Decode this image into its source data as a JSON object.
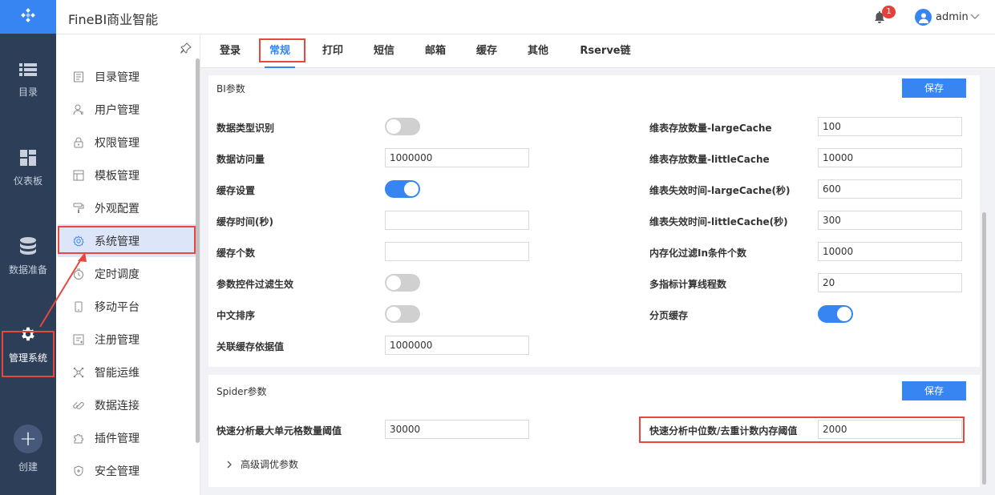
{
  "app": {
    "title": "FineBI商业智能"
  },
  "header": {
    "notification_count": "1",
    "username": "admin"
  },
  "leftnav": [
    {
      "label": "目录",
      "icon": "list-icon"
    },
    {
      "label": "仪表板",
      "icon": "dashboard-icon"
    },
    {
      "label": "数据准备",
      "icon": "database-icon"
    },
    {
      "label": "管理系统",
      "icon": "gear-icon",
      "active": true
    },
    {
      "label": "创建",
      "icon": "plus-icon"
    }
  ],
  "sidebar": {
    "items": [
      {
        "label": "目录管理"
      },
      {
        "label": "用户管理"
      },
      {
        "label": "权限管理"
      },
      {
        "label": "模板管理"
      },
      {
        "label": "外观配置"
      },
      {
        "label": "系统管理",
        "active": true
      },
      {
        "label": "定时调度"
      },
      {
        "label": "移动平台"
      },
      {
        "label": "注册管理"
      },
      {
        "label": "智能运维"
      },
      {
        "label": "数据连接"
      },
      {
        "label": "插件管理"
      },
      {
        "label": "安全管理"
      }
    ]
  },
  "tabs": [
    "登录",
    "常规",
    "打印",
    "短信",
    "邮箱",
    "缓存",
    "其他",
    "Rserve链接"
  ],
  "active_tab": "常规",
  "bi_params": {
    "title": "BI参数",
    "save_label": "保存",
    "left": [
      {
        "label": "数据类型识别",
        "type": "toggle",
        "on": false
      },
      {
        "label": "数据访问量",
        "type": "input",
        "value": "1000000"
      },
      {
        "label": "缓存设置",
        "type": "toggle",
        "on": true
      },
      {
        "label": "缓存时间(秒)",
        "type": "input",
        "value": ""
      },
      {
        "label": "缓存个数",
        "type": "input",
        "value": ""
      },
      {
        "label": "参数控件过滤生效",
        "type": "toggle",
        "on": false
      },
      {
        "label": "中文排序",
        "type": "toggle",
        "on": false
      },
      {
        "label": "关联缓存依据值",
        "type": "input",
        "value": "1000000"
      }
    ],
    "right": [
      {
        "label": "维表存放数量-largeCache",
        "type": "input",
        "value": "100"
      },
      {
        "label": "维表存放数量-littleCache",
        "type": "input",
        "value": "10000"
      },
      {
        "label": "维表失效时间-largeCache(秒)",
        "type": "input",
        "value": "600"
      },
      {
        "label": "维表失效时间-littleCache(秒)",
        "type": "input",
        "value": "300"
      },
      {
        "label": "内存化过滤In条件个数",
        "type": "input",
        "value": "10000"
      },
      {
        "label": "多指标计算线程数",
        "type": "input",
        "value": "20"
      },
      {
        "label": "分页缓存",
        "type": "toggle",
        "on": true
      }
    ]
  },
  "spider_params": {
    "title": "Spider参数",
    "save_label": "保存",
    "fast_cell_label": "快速分析最大单元格数量阈值",
    "fast_cell_value": "30000",
    "fast_median_label": "快速分析中位数/去重计数内存阈值",
    "fast_median_value": "2000",
    "advanced_label": "高级调优参数"
  },
  "colors": {
    "accent": "#3685f2",
    "nav_bg": "#2c3e58",
    "annotation": "#e8473e"
  }
}
